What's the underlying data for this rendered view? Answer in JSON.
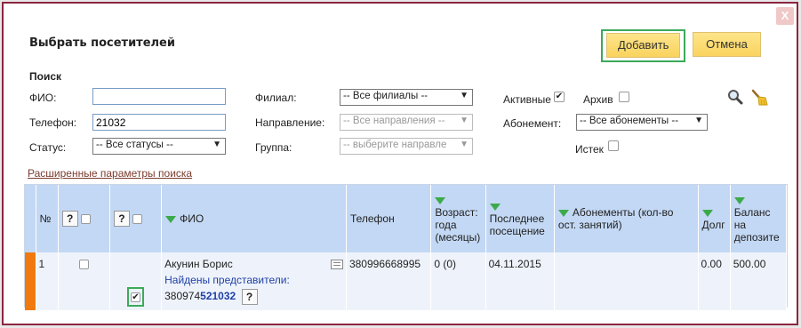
{
  "dialog": {
    "close_label": "X",
    "title": "Выбрать посетителей",
    "add_label": "Добавить",
    "cancel_label": "Отмена"
  },
  "search": {
    "section_label": "Поиск",
    "fio_label": "ФИО:",
    "fio_value": "",
    "phone_label": "Телефон:",
    "phone_value": "21032",
    "status_label": "Статус:",
    "status_value": "-- Все статусы --",
    "branch_label": "Филиал:",
    "branch_value": "-- Все филиалы --",
    "direction_label": "Направление:",
    "direction_value": "-- Все направления --",
    "group_label": "Группа:",
    "group_value": "-- выберите направле",
    "active_label": "Активные",
    "active_checked": true,
    "archive_label": "Архив",
    "archive_checked": false,
    "subscription_label": "Абонемент:",
    "subscription_value": "-- Все абонементы --",
    "expired_label": "Истек",
    "expired_checked": false,
    "advanced_link": "Расширенные параметры поиска"
  },
  "grid": {
    "headers": {
      "num": "№",
      "q": "?",
      "fio": "ФИО",
      "phone": "Телефон",
      "age": "Возраст: года (месяцы)",
      "last_visit": "Последнее посещение",
      "subscriptions": "Абонементы (кол-во ост. занятий)",
      "debt": "Долг",
      "balance": "Баланс на депозите"
    },
    "rows": [
      {
        "num": "1",
        "name": "Акунин Борис",
        "reps_label": "Найдены представители:",
        "rep_phone_prefix": "380974",
        "rep_phone_match": "521032",
        "phone": "380996668995",
        "age": "0 (0)",
        "last_visit": "04.11.2015",
        "subscriptions": "",
        "debt": "0.00",
        "balance": "500.00"
      }
    ]
  },
  "colors": {
    "accent_button": "#f9d35e",
    "header_bg": "#c3d8f4",
    "row_marker": "#f07a10",
    "sort_icon": "#3caa4a",
    "highlight_border": "#3caa5a"
  }
}
